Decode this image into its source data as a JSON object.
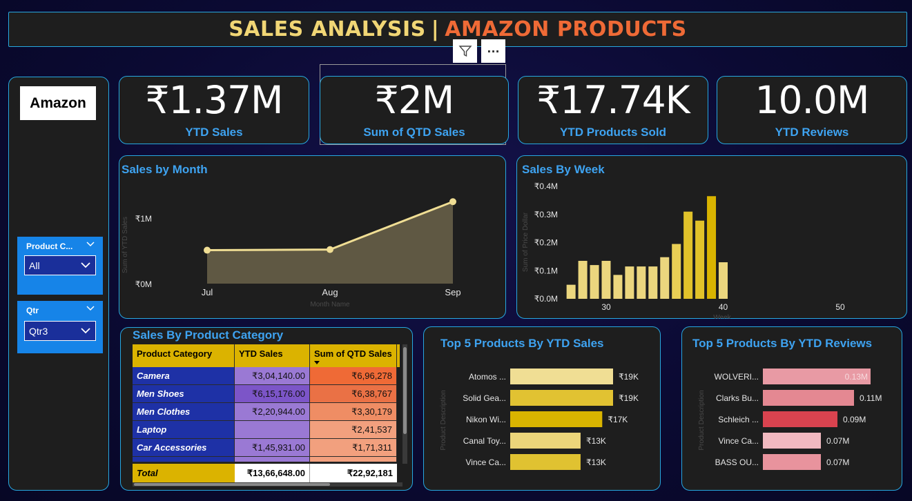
{
  "header": {
    "title_part1": "SALES ANALYSIS",
    "separator": "|",
    "title_part2": "AMAZON PRODUCTS"
  },
  "visual_header": {
    "filter_icon": "funnel-icon",
    "more_icon": "ellipsis-icon",
    "more_label": "···"
  },
  "brand": {
    "logo_text": "Amazon"
  },
  "kpis": [
    {
      "value": "₹1.37M",
      "label": "YTD Sales"
    },
    {
      "value": "₹2M",
      "label": "Sum of QTD Sales"
    },
    {
      "value": "₹17.74K",
      "label": "YTD Products Sold"
    },
    {
      "value": "10.0M",
      "label": "YTD Reviews"
    }
  ],
  "slicers": {
    "product_category": {
      "label": "Product C...",
      "value": "All"
    },
    "qtr": {
      "label": "Qtr",
      "value": "Qtr3"
    }
  },
  "colors": {
    "accent_blue": "#3ea3f1",
    "border": "#27a9e1",
    "gold": "#dbb300",
    "orange": "#ef6a36",
    "pink": "#e0838f",
    "navy": "#1e31a6",
    "purple": "#9a79d4"
  },
  "chart_data": [
    {
      "type": "area",
      "title": "Sales by Month",
      "xlabel": "Month Name",
      "ylabel": "Sum of YTD Sales",
      "categories": [
        "Jul",
        "Aug",
        "Sep"
      ],
      "values": [
        0.51,
        0.52,
        1.25
      ],
      "ytick_labels": [
        "₹0M",
        "₹1M"
      ],
      "ylim": [
        0,
        1.3
      ]
    },
    {
      "type": "bar",
      "title": "Sales By Week",
      "xlabel": "Week",
      "ylabel": "Sum of Price Dollar",
      "x": [
        27,
        28,
        29,
        30,
        31,
        32,
        33,
        34,
        35,
        36,
        37,
        38,
        39,
        40
      ],
      "values": [
        0.05,
        0.135,
        0.12,
        0.135,
        0.085,
        0.115,
        0.115,
        0.115,
        0.148,
        0.195,
        0.31,
        0.278,
        0.365,
        0.13
      ],
      "ytick_labels": [
        "₹0.0M",
        "₹0.1M",
        "₹0.2M",
        "₹0.3M",
        "₹0.4M"
      ],
      "xtick_labels": [
        "30",
        "40",
        "50"
      ],
      "ylim": [
        0,
        0.4
      ]
    },
    {
      "type": "table",
      "title": "Sales By Product Category",
      "columns": [
        "Product Category",
        "YTD Sales",
        "Sum of QTD Sales"
      ],
      "rows": [
        [
          "Camera",
          "₹3,04,140.00",
          "₹6,96,278"
        ],
        [
          "Men Shoes",
          "₹6,15,176.00",
          "₹6,38,767"
        ],
        [
          "Men Clothes",
          "₹2,20,944.00",
          "₹3,30,179"
        ],
        [
          "Laptop",
          "",
          "₹2,41,537"
        ],
        [
          "Car Accessories",
          "₹1,45,931.00",
          "₹1,71,311"
        ]
      ],
      "total": [
        "Total",
        "₹13,66,648.00",
        "₹22,92,181"
      ]
    },
    {
      "type": "bar",
      "orientation": "horizontal",
      "title": "Top 5 Products By YTD Sales",
      "ylabel": "Product Description",
      "categories": [
        "Atomos ...",
        "Solid Gea...",
        "Nikon Wi...",
        "Canal Toy...",
        "Vince Ca..."
      ],
      "values": [
        19,
        19,
        17,
        13,
        13
      ],
      "data_labels": [
        "₹19K",
        "₹19K",
        "₹17K",
        "₹13K",
        "₹13K"
      ]
    },
    {
      "type": "bar",
      "orientation": "horizontal",
      "title": "Top 5 Products By YTD Reviews",
      "ylabel": "Product Description",
      "categories": [
        "WOLVERI...",
        "Clarks Bu...",
        "Schleich ...",
        "Vince Ca...",
        "BASS OU..."
      ],
      "values": [
        0.13,
        0.11,
        0.09,
        0.07,
        0.07
      ],
      "data_labels": [
        "0.13M",
        "0.11M",
        "0.09M",
        "0.07M",
        "0.07M"
      ]
    }
  ]
}
